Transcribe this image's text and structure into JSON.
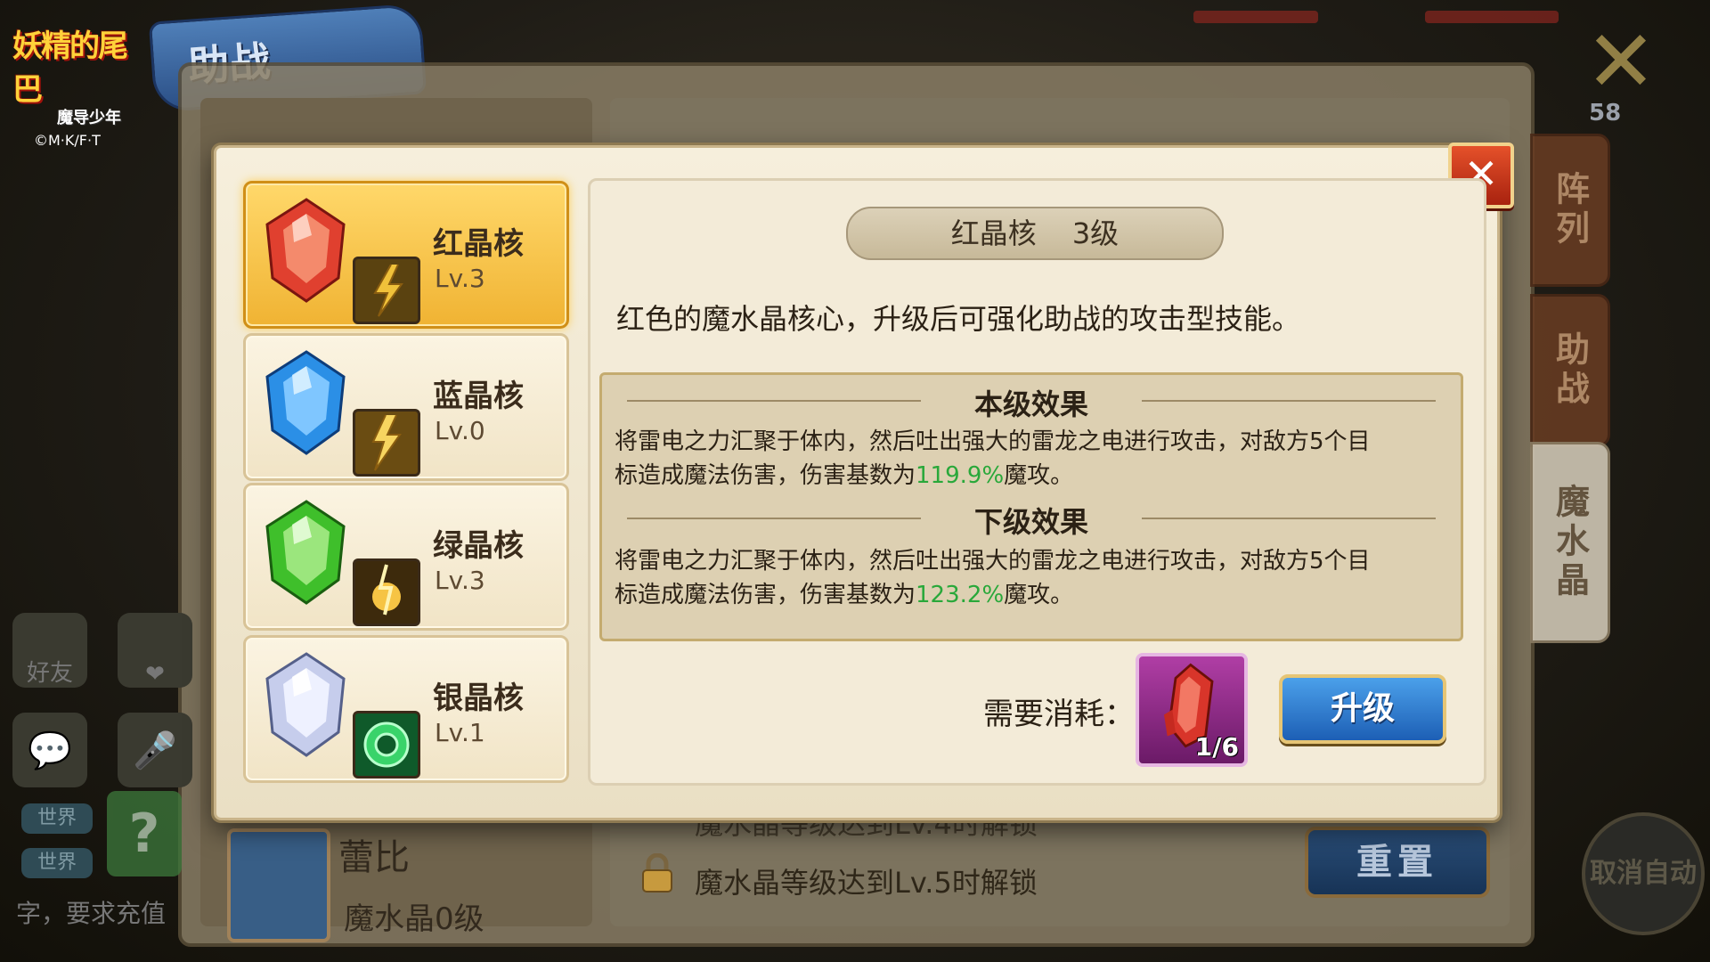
{
  "logo": {
    "title": "妖精的尾巴",
    "subtitle": "魔导少年",
    "copyright": "©M·K/F·T"
  },
  "screen_title": "助战",
  "level_badge": "58",
  "side_tabs": [
    {
      "label": "阵列"
    },
    {
      "label": "助战"
    },
    {
      "label": "魔水晶"
    }
  ],
  "chat": {
    "friends": "好友",
    "world_tag": "世界",
    "message": "字，要求充值"
  },
  "background": {
    "hero_name": "蕾比",
    "hero_level": "魔水晶0级",
    "unlock_text": "魔水晶等级达到Lv.5时解锁",
    "unlock_text_partial": "魔水晶等级达到Lv.4时解锁",
    "reset_label": "重置",
    "auto_label": "取消自动"
  },
  "dialog": {
    "crystals": [
      {
        "name": "红晶核",
        "level": "Lv.3",
        "color": "#e23a2f"
      },
      {
        "name": "蓝晶核",
        "level": "Lv.0",
        "color": "#2f8fe2"
      },
      {
        "name": "绿晶核",
        "level": "Lv.3",
        "color": "#3fbf2b"
      },
      {
        "name": "银晶核",
        "level": "Lv.1",
        "color": "#c9d4f0"
      }
    ],
    "selected_name": "红晶核",
    "selected_rank": "3级",
    "description": "红色的魔水晶核心，升级后可强化助战的攻击型技能。",
    "current_effect": {
      "title": "本级效果",
      "text_a": "将雷电之力汇聚于体内，然后吐出强大的雷龙之电进行攻击，对敌方5个目",
      "text_b": "标造成魔法伤害，伤害基数为",
      "value": "119.9%",
      "suffix": "魔攻。"
    },
    "next_effect": {
      "title": "下级效果",
      "text_a": "将雷电之力汇聚于体内，然后吐出强大的雷龙之电进行攻击，对敌方5个目",
      "text_b": "标造成魔法伤害，伤害基数为",
      "value": "123.2%",
      "suffix": "魔攻。"
    },
    "cost_label": "需要消耗：",
    "cost_count": "1/6",
    "upgrade_label": "升级",
    "close_symbol": "✕"
  }
}
